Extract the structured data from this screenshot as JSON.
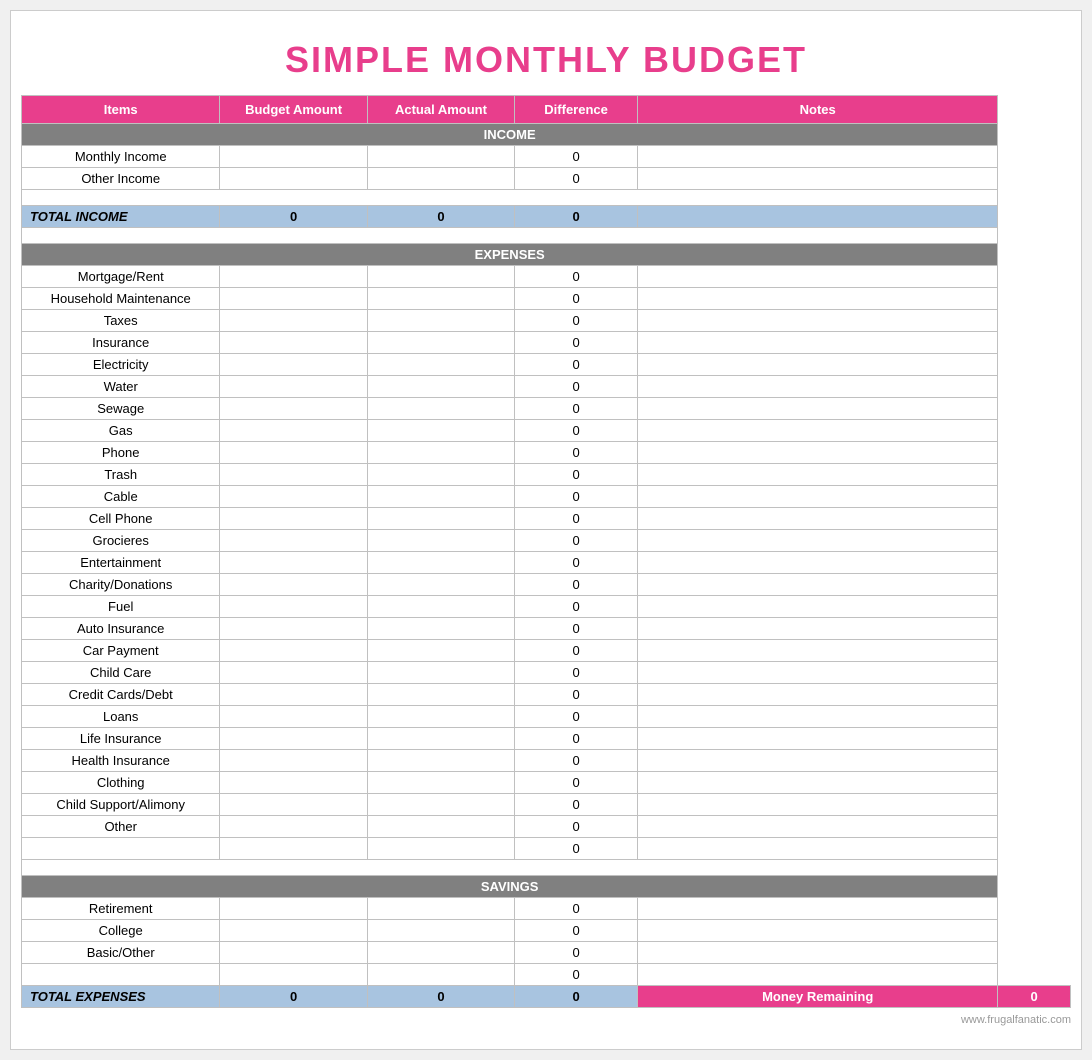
{
  "title": "SIMPLE MONTHLY BUDGET",
  "headers": {
    "items": "Items",
    "budget_amount": "Budget Amount",
    "actual_amount": "Actual Amount",
    "difference": "Difference",
    "notes": "Notes"
  },
  "sections": {
    "income": {
      "label": "INCOME",
      "rows": [
        {
          "item": "Monthly Income",
          "diff": "0"
        },
        {
          "item": "Other Income",
          "diff": "0"
        }
      ],
      "total": {
        "label": "TOTAL INCOME",
        "budget": "0",
        "actual": "0",
        "diff": "0"
      }
    },
    "expenses": {
      "label": "EXPENSES",
      "rows": [
        {
          "item": "Mortgage/Rent",
          "diff": "0"
        },
        {
          "item": "Household Maintenance",
          "diff": "0"
        },
        {
          "item": "Taxes",
          "diff": "0"
        },
        {
          "item": "Insurance",
          "diff": "0"
        },
        {
          "item": "Electricity",
          "diff": "0"
        },
        {
          "item": "Water",
          "diff": "0"
        },
        {
          "item": "Sewage",
          "diff": "0"
        },
        {
          "item": "Gas",
          "diff": "0"
        },
        {
          "item": "Phone",
          "diff": "0"
        },
        {
          "item": "Trash",
          "diff": "0"
        },
        {
          "item": "Cable",
          "diff": "0"
        },
        {
          "item": "Cell Phone",
          "diff": "0"
        },
        {
          "item": "Grocieres",
          "diff": "0"
        },
        {
          "item": "Entertainment",
          "diff": "0"
        },
        {
          "item": "Charity/Donations",
          "diff": "0"
        },
        {
          "item": "Fuel",
          "diff": "0"
        },
        {
          "item": "Auto Insurance",
          "diff": "0"
        },
        {
          "item": "Car Payment",
          "diff": "0"
        },
        {
          "item": "Child Care",
          "diff": "0"
        },
        {
          "item": "Credit Cards/Debt",
          "diff": "0"
        },
        {
          "item": "Loans",
          "diff": "0"
        },
        {
          "item": "Life Insurance",
          "diff": "0"
        },
        {
          "item": "Health Insurance",
          "diff": "0"
        },
        {
          "item": "Clothing",
          "diff": "0"
        },
        {
          "item": "Child Support/Alimony",
          "diff": "0"
        },
        {
          "item": "Other",
          "diff": "0"
        },
        {
          "item": "",
          "diff": "0"
        }
      ],
      "total": {
        "label": "TOTAL EXPENSES",
        "budget": "0",
        "actual": "0",
        "diff": "0",
        "money_remaining_label": "Money Remaining",
        "money_remaining_value": "0"
      }
    },
    "savings": {
      "label": "SAVINGS",
      "rows": [
        {
          "item": "Retirement",
          "diff": "0"
        },
        {
          "item": "College",
          "diff": "0"
        },
        {
          "item": "Basic/Other",
          "diff": "0"
        },
        {
          "item": "",
          "diff": "0"
        }
      ]
    }
  },
  "watermark": "www.frugalfanatic.com"
}
